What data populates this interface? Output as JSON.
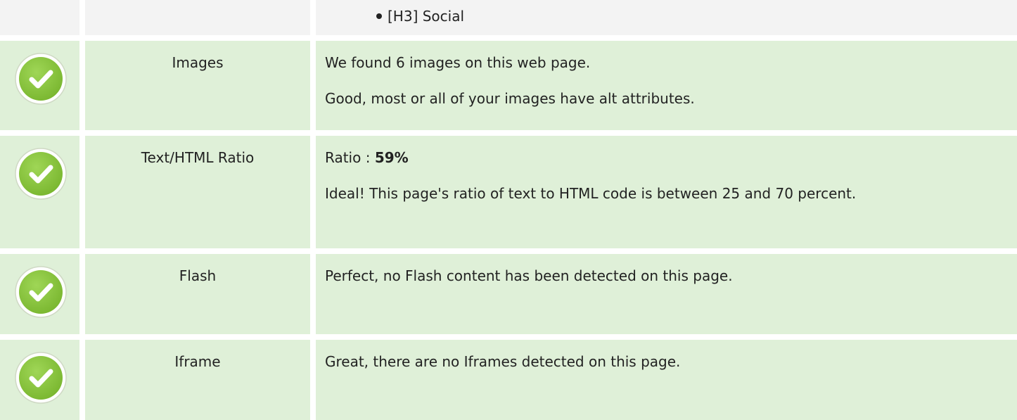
{
  "top_row": {
    "heading_item": "[H3] Social"
  },
  "rows": [
    {
      "icon": "check-circle-icon",
      "label": "Images",
      "lines": [
        "We found 6 images on this web page.",
        "Good, most or all of your images have alt attributes."
      ]
    },
    {
      "icon": "check-circle-icon",
      "label": "Text/HTML Ratio",
      "ratio_prefix": "Ratio : ",
      "ratio_value": "59%",
      "lines": [
        "Ideal! This page's ratio of text to HTML code is between 25 and 70 percent."
      ]
    },
    {
      "icon": "check-circle-icon",
      "label": "Flash",
      "lines": [
        "Perfect, no Flash content has been detected on this page."
      ]
    },
    {
      "icon": "check-circle-icon",
      "label": "Iframe",
      "lines": [
        "Great, there are no Iframes detected on this page."
      ]
    }
  ],
  "colors": {
    "row_green_bg": "#dff0d8",
    "row_gray_bg": "#f3f3f3",
    "check_green": "#8cc63f",
    "text": "#222222"
  }
}
